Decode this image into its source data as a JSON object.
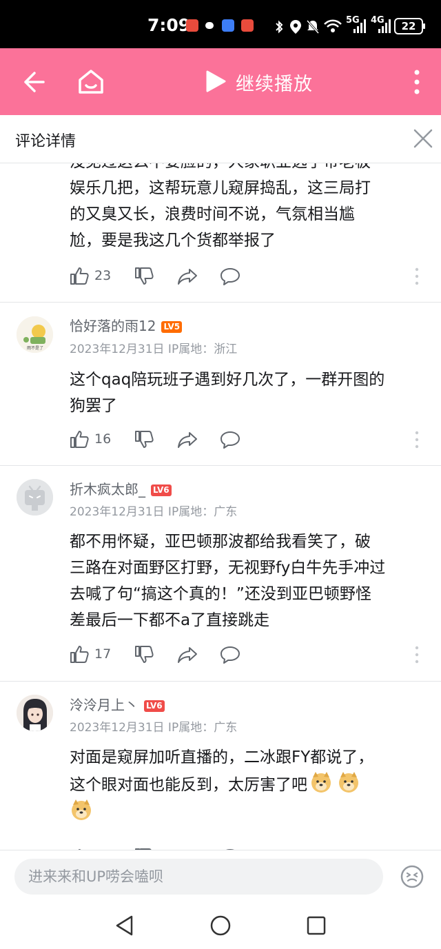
{
  "status_bar": {
    "time": "7:09",
    "network_5g": "5G",
    "network_4g": "4G",
    "battery": "22"
  },
  "topbar": {
    "play_label": "继续播放"
  },
  "detail_header": {
    "title": "评论详情"
  },
  "comments": [
    {
      "body_lines": [
        "没见过这么不要脸的，人家职业选手带老板",
        "娱乐几把，这帮玩意儿窥屏捣乱，这三局打",
        "的又臭又长，浪费时间不说，气氛相当尴",
        "尬，要是我这几个货都举报了"
      ],
      "likes": "23"
    },
    {
      "username": "恰好落的雨12",
      "level": "LV5",
      "meta": "2023年12月31日 IP属地：浙江",
      "body_lines": [
        "这个qaq陪玩班子遇到好几次了，一群开图的",
        "狗罢了"
      ],
      "likes": "16",
      "avatar_text": "雨不是了"
    },
    {
      "username": "折木疯太郎_",
      "level": "LV6",
      "meta": "2023年12月31日 IP属地：广东",
      "body_lines": [
        "都不用怀疑，亚巴顿那波都给我看笑了，破",
        "三路在对面野区打野，无视野fy白牛先手冲过",
        "去喊了句“搞这个真的！”还没到亚巴顿野怪",
        "差最后一下都不a了直接跳走"
      ],
      "likes": "17"
    },
    {
      "username": "泠泠月上丶",
      "level": "LV6",
      "meta": "2023年12月31日 IP属地：广东",
      "body_line1": "对面是窥屏加听直播的，二冰跟FY都说了，",
      "body_line2": "这个眼对面也能反到，太厉害了吧"
    }
  ],
  "level_colors": {
    "LV5": "#ff6c00",
    "LV6": "#f04c49"
  },
  "input": {
    "placeholder": "进来来和UP唠会嗑呗"
  },
  "icons": {
    "back": "arrow-left-icon",
    "home": "home-icon",
    "play": "play-icon",
    "more": "more-vertical-icon",
    "close": "close-icon",
    "like": "thumb-up-icon",
    "dislike": "thumb-down-icon",
    "share": "share-icon",
    "reply": "comment-bubble-icon",
    "emoji": "emoji-icon"
  },
  "colors": {
    "brand_pink": "#fb7299",
    "text_primary": "#18191c",
    "text_secondary": "#61666d",
    "text_meta": "#9499a0"
  }
}
